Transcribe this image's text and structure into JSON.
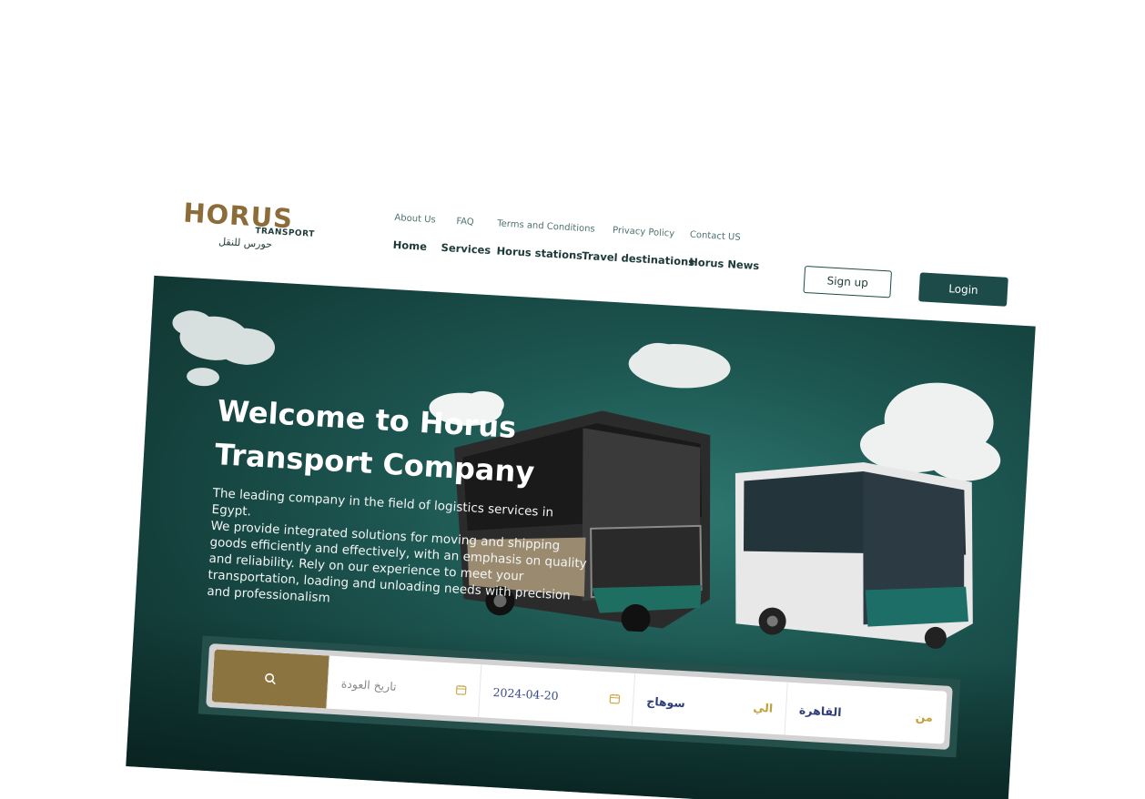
{
  "brand": {
    "name": "HORUS",
    "sub": "TRANSPORT",
    "arabic": "حورس للنقل",
    "colors": {
      "gold": "#8c6d3a",
      "teal": "#1d4b49"
    }
  },
  "nav": {
    "top_links": [
      "About Us",
      "FAQ",
      "Terms and Conditions",
      "Privacy Policy",
      "Contact US"
    ],
    "main_links": [
      "Home",
      "Services",
      "Horus stations",
      "Travel destinations",
      "Horus News"
    ],
    "signup_label": "Sign up",
    "login_label": "Login"
  },
  "hero": {
    "title_line1": "Welcome to Horus",
    "title_line2": "Transport Company",
    "lines": [
      "The leading company in the field of logistics services in Egypt.",
      "We provide integrated solutions for moving and shipping",
      "goods efficiently and effectively, with an emphasis on quality",
      "and reliability. Rely on our experience to meet your",
      "transportation, loading and unloading needs with precision",
      "and professionalism"
    ]
  },
  "search": {
    "button_icon": "search-icon",
    "return_date_placeholder": "تاريخ العودة",
    "departure_date": "2024-04-20",
    "to_label": "الي",
    "to_value": "سوهاج",
    "from_label": "من",
    "from_value": "القاهرة"
  }
}
